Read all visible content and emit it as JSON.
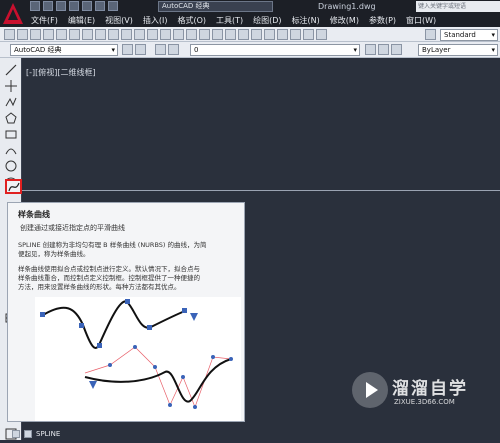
{
  "titlebar": {
    "workspace": "AutoCAD 经典",
    "document": "Drawing1.dwg",
    "search_placeholder": "键入关键字或短语"
  },
  "menu": [
    "文件(F)",
    "编辑(E)",
    "视图(V)",
    "插入(I)",
    "格式(O)",
    "工具(T)",
    "绘图(D)",
    "标注(N)",
    "修改(M)",
    "参数(P)",
    "窗口(W)"
  ],
  "toolbar": {
    "text_style": "Standard",
    "workspace_combo": "AutoCAD 经典",
    "layer_combo": "0",
    "color_combo": "ByLayer"
  },
  "viewport": {
    "label": "[-][俯视][二维线框]"
  },
  "tooltip": {
    "title": "样条曲线",
    "subtitle": "创建通过或接近指定点的平滑曲线",
    "para1_line1": "SPLINE 创建称为非均匀有理 B 样条曲线 (NURBS) 的曲线，为简",
    "para1_line2": "便起见，称为样条曲线。",
    "para2_line1": "样条曲线使用拟合点或控制点进行定义。默认情况下，拟合点与",
    "para2_line2": "样条曲线重合，而控制点定义控制框。控制框提供了一种便捷的",
    "para2_line3": "方法，用来设置样条曲线的形状。每种方法都有其优点。"
  },
  "command": {
    "label": "SPLINE"
  },
  "watermark": {
    "name": "溜溜自学",
    "url": "ZIXUE.3D66.COM"
  }
}
